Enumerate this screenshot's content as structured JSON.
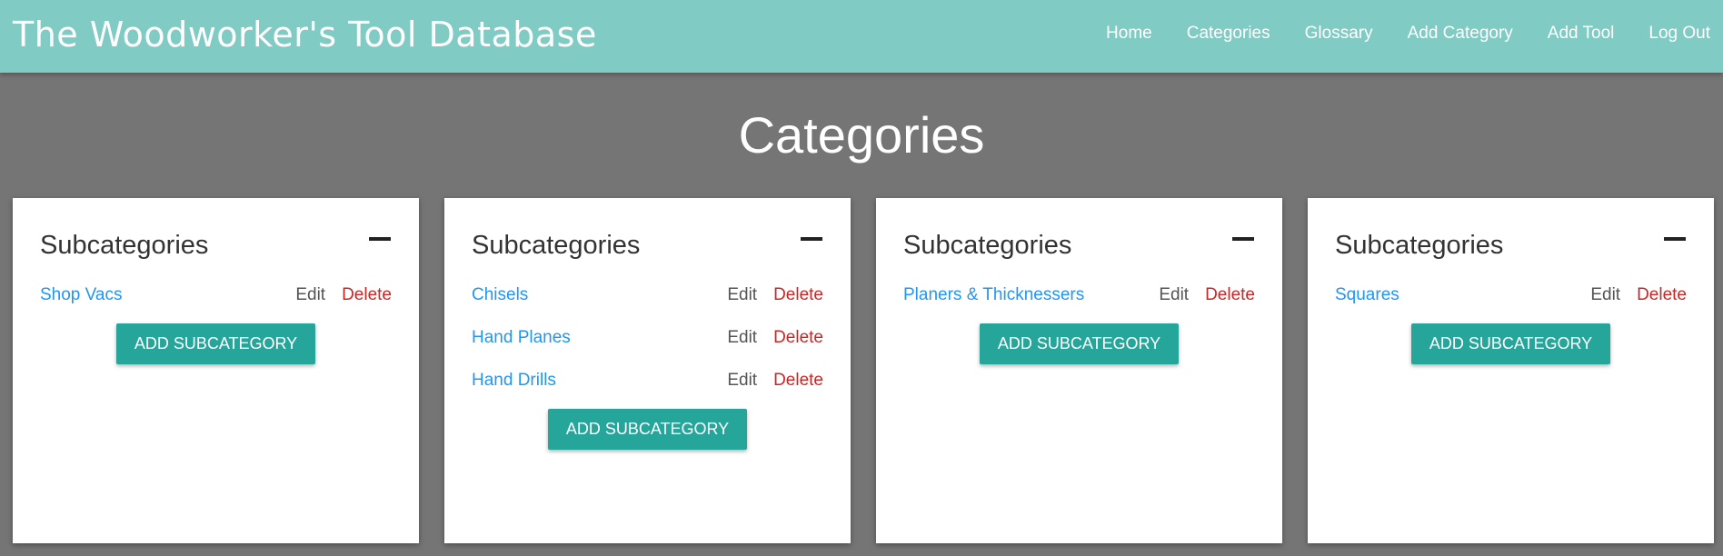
{
  "nav": {
    "brand": "The Woodworker's Tool Database",
    "links": [
      "Home",
      "Categories",
      "Glossary",
      "Add Category",
      "Add Tool",
      "Log Out"
    ]
  },
  "page": {
    "title": "Categories"
  },
  "cards": [
    {
      "title": "Subcategories",
      "items": [
        "Shop Vacs"
      ],
      "button": "ADD SUBCATEGORY"
    },
    {
      "title": "Subcategories",
      "items": [
        "Chisels",
        "Hand Planes",
        "Hand Drills"
      ],
      "button": "ADD SUBCATEGORY"
    },
    {
      "title": "Subcategories",
      "items": [
        "Planers & Thicknessers"
      ],
      "button": "ADD SUBCATEGORY"
    },
    {
      "title": "Subcategories",
      "items": [
        "Squares"
      ],
      "button": "ADD SUBCATEGORY"
    }
  ],
  "labels": {
    "edit": "Edit",
    "delete": "Delete"
  },
  "icons": {
    "collapse": "minus-icon"
  },
  "colors": {
    "navbar": "#80cbc4",
    "background": "#757575",
    "button": "#26a69a",
    "link": "#2196f3",
    "delete": "#c62828"
  }
}
